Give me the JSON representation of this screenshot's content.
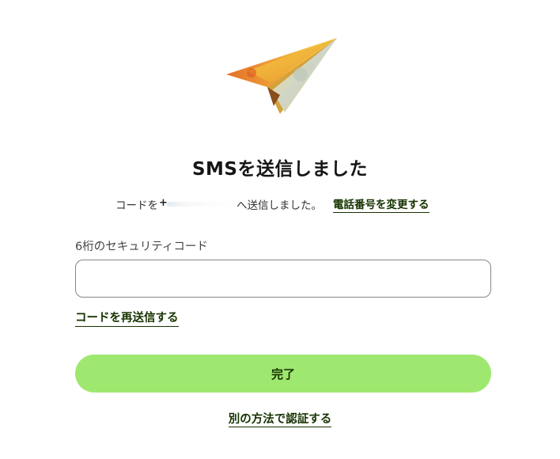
{
  "header": {
    "icon": "paper-plane-icon",
    "title": "SMSを送信しました"
  },
  "sent_message": {
    "prefix": "コードを",
    "phone_prefix": "+",
    "suffix": "へ送信しました。",
    "change_phone_link": "電話番号を変更する"
  },
  "form": {
    "code_label": "6桁のセキュリティコード",
    "code_value": "",
    "resend_link": "コードを再送信する",
    "submit_label": "完了",
    "alt_auth_link": "別の方法で認証する"
  },
  "colors": {
    "accent": "#9fe870",
    "link": "#163300",
    "input_border": "#868685"
  }
}
